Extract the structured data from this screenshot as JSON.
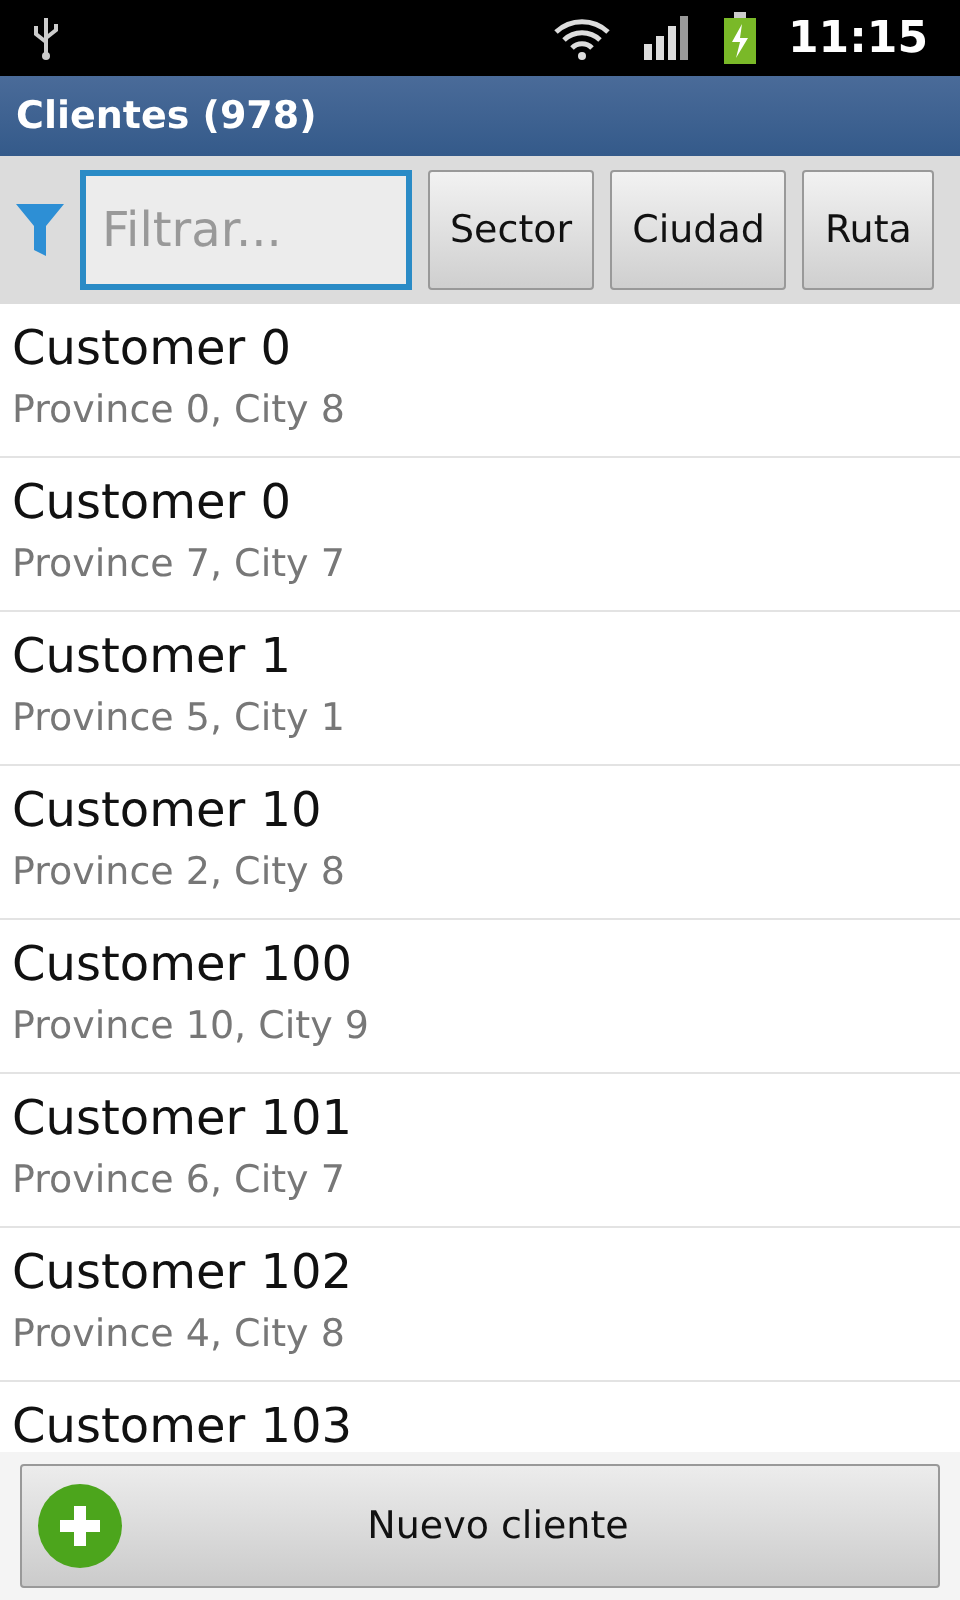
{
  "status_bar": {
    "time": "11:15"
  },
  "title": "Clientes (978)",
  "filter": {
    "placeholder": "Filtrar...",
    "buttons": [
      "Sector",
      "Ciudad",
      "Ruta"
    ]
  },
  "customers": [
    {
      "name": "Customer 0",
      "location": "Province 0, City 8"
    },
    {
      "name": "Customer 0",
      "location": "Province 7, City 7"
    },
    {
      "name": "Customer 1",
      "location": "Province 5, City 1"
    },
    {
      "name": "Customer 10",
      "location": "Province 2, City 8"
    },
    {
      "name": "Customer 100",
      "location": "Province 10, City 9"
    },
    {
      "name": "Customer 101",
      "location": "Province 6, City 7"
    },
    {
      "name": "Customer 102",
      "location": "Province 4, City 8"
    },
    {
      "name": "Customer 103"
    }
  ],
  "new_button": "Nuevo cliente"
}
